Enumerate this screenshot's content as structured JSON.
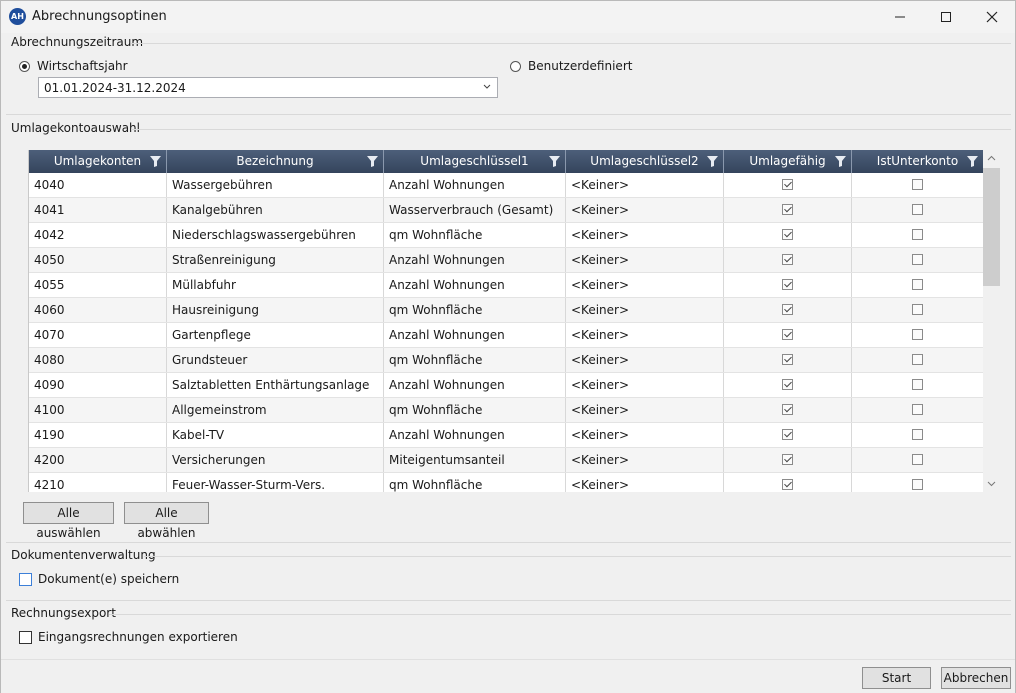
{
  "window": {
    "title": "Abrechnungsoptinen",
    "app_icon_text": "AH"
  },
  "period": {
    "group_label": "Abrechnungszeitraum",
    "radio_fiscal_label": "Wirtschaftsjahr",
    "radio_custom_label": "Benutzerdefiniert",
    "fiscal_selected": true,
    "combo_value": "01.01.2024-31.12.2024"
  },
  "accounts": {
    "group_label": "Umlagekontoauswahl",
    "columns": [
      "Umlagekonten",
      "Bezeichnung",
      "Umlageschlüssel1",
      "Umlageschlüssel2",
      "Umlagefähig",
      "IstUnterkonto"
    ],
    "rows": [
      {
        "konto": "4040",
        "bez": "Wassergebühren",
        "s1": "Anzahl Wohnungen",
        "s2": "<Keiner>",
        "umlage": true,
        "unter": false
      },
      {
        "konto": "4041",
        "bez": "Kanalgebühren",
        "s1": "Wasserverbrauch (Gesamt)",
        "s2": "<Keiner>",
        "umlage": true,
        "unter": false
      },
      {
        "konto": "4042",
        "bez": "Niederschlagswassergebühren",
        "s1": "qm Wohnfläche",
        "s2": "<Keiner>",
        "umlage": true,
        "unter": false
      },
      {
        "konto": "4050",
        "bez": "Straßenreinigung",
        "s1": "Anzahl Wohnungen",
        "s2": "<Keiner>",
        "umlage": true,
        "unter": false
      },
      {
        "konto": "4055",
        "bez": "Müllabfuhr",
        "s1": "Anzahl Wohnungen",
        "s2": "<Keiner>",
        "umlage": true,
        "unter": false
      },
      {
        "konto": "4060",
        "bez": "Hausreinigung",
        "s1": "qm Wohnfläche",
        "s2": "<Keiner>",
        "umlage": true,
        "unter": false
      },
      {
        "konto": "4070",
        "bez": "Gartenpflege",
        "s1": "Anzahl Wohnungen",
        "s2": "<Keiner>",
        "umlage": true,
        "unter": false
      },
      {
        "konto": "4080",
        "bez": "Grundsteuer",
        "s1": "qm Wohnfläche",
        "s2": "<Keiner>",
        "umlage": true,
        "unter": false
      },
      {
        "konto": "4090",
        "bez": "Salztabletten Enthärtungsanlage",
        "s1": "Anzahl Wohnungen",
        "s2": "<Keiner>",
        "umlage": true,
        "unter": false
      },
      {
        "konto": "4100",
        "bez": "Allgemeinstrom",
        "s1": "qm Wohnfläche",
        "s2": "<Keiner>",
        "umlage": true,
        "unter": false
      },
      {
        "konto": "4190",
        "bez": "Kabel-TV",
        "s1": "Anzahl Wohnungen",
        "s2": "<Keiner>",
        "umlage": true,
        "unter": false
      },
      {
        "konto": "4200",
        "bez": "Versicherungen",
        "s1": "Miteigentumsanteil",
        "s2": "<Keiner>",
        "umlage": true,
        "unter": false
      },
      {
        "konto": "4210",
        "bez": "Feuer-Wasser-Sturm-Vers.",
        "s1": "qm Wohnfläche",
        "s2": "<Keiner>",
        "umlage": true,
        "unter": false
      }
    ],
    "select_all_label": "Alle auswählen",
    "deselect_all_label": "Alle abwählen"
  },
  "documents": {
    "group_label": "Dokumentenverwaltung",
    "save_label": "Dokument(e) speichern"
  },
  "invoice_export": {
    "group_label": "Rechnungsexport",
    "export_label": "Eingangsrechnungen exportieren"
  },
  "footer": {
    "start_label": "Start",
    "cancel_label": "Abbrechen"
  },
  "colors": {
    "header_bg": "#3f5069",
    "app_icon": "#1f4e9c",
    "focus_blue": "#3c7fd8"
  }
}
